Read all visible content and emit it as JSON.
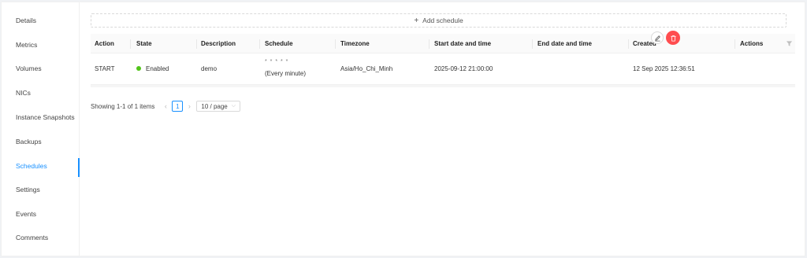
{
  "sidebar": {
    "items": [
      {
        "label": "Details"
      },
      {
        "label": "Metrics"
      },
      {
        "label": "Volumes"
      },
      {
        "label": "NICs"
      },
      {
        "label": "Instance Snapshots"
      },
      {
        "label": "Backups"
      },
      {
        "label": "Schedules",
        "active": true
      },
      {
        "label": "Settings"
      },
      {
        "label": "Events"
      },
      {
        "label": "Comments"
      }
    ]
  },
  "add_schedule": {
    "label": "Add schedule"
  },
  "table": {
    "columns": [
      "Action",
      "State",
      "Description",
      "Schedule",
      "Timezone",
      "Start date and time",
      "End date and time",
      "Created",
      "Actions"
    ],
    "rows": [
      {
        "action": "START",
        "state": "Enabled",
        "description": "demo",
        "schedule_cron": "* * * * *",
        "schedule_text": "(Every minute)",
        "timezone": "Asia/Ho_Chi_Minh",
        "start": "2025-09-12 21:00:00",
        "end": "",
        "created": "12 Sep 2025 12:36:51"
      }
    ]
  },
  "pagination": {
    "total_text": "Showing 1-1 of 1 items",
    "current_page": "1",
    "page_size": "10 / page"
  },
  "colors": {
    "accent": "#1890ff",
    "enabled": "#52c41a",
    "danger": "#ff4d4f"
  }
}
